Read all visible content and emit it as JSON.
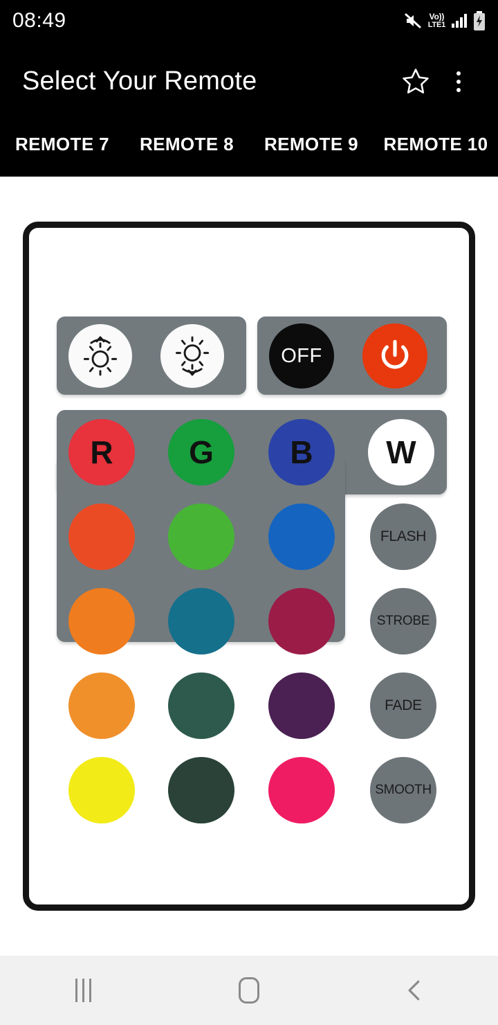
{
  "status_bar": {
    "clock": "08:49",
    "icons": [
      "mute-icon",
      "volte-icon",
      "signal-icon",
      "battery-charging-icon"
    ],
    "volte_top": "Vo))",
    "volte_bottom": "LTE1"
  },
  "app_bar": {
    "title": "Select Your Remote",
    "favorite_icon": "star-outline-icon",
    "overflow_icon": "overflow-menu-icon",
    "tabs": [
      {
        "label": "REMOTE 7",
        "selected": false
      },
      {
        "label": "REMOTE 8",
        "selected": false
      },
      {
        "label": "REMOTE 9",
        "selected": false
      },
      {
        "label": "REMOTE 10",
        "selected": false
      }
    ]
  },
  "remote": {
    "body_color": "#FFFFFF",
    "border_color": "#141414",
    "panel_color": "#727A7E",
    "top_row": [
      {
        "name": "brightness-up",
        "icon": "sun-up-icon",
        "label": "",
        "color": "#FAFAFA"
      },
      {
        "name": "brightness-down",
        "icon": "sun-down-icon",
        "label": "",
        "color": "#FAFAFA"
      },
      {
        "name": "off",
        "icon": "",
        "label": "OFF",
        "color": "#0C0C0C"
      },
      {
        "name": "power",
        "icon": "power-icon",
        "label": "",
        "color": "#E8380D"
      }
    ],
    "color_buttons": [
      {
        "label": "R",
        "color": "#E8323C"
      },
      {
        "label": "G",
        "color": "#179E3D"
      },
      {
        "label": "B",
        "color": "#2B43A8"
      },
      {
        "label": "W",
        "color": "#FFFFFF"
      },
      {
        "label": "",
        "color": "#EB4B24"
      },
      {
        "label": "",
        "color": "#47B436"
      },
      {
        "label": "",
        "color": "#1565C0"
      },
      {
        "label": "",
        "color": "#EF7C1E"
      },
      {
        "label": "",
        "color": "#15708C"
      },
      {
        "label": "",
        "color": "#9B1C47"
      },
      {
        "label": "",
        "color": "#F0902B"
      },
      {
        "label": "",
        "color": "#2D5A4C"
      },
      {
        "label": "",
        "color": "#4A2152"
      },
      {
        "label": "",
        "color": "#F2EB18"
      },
      {
        "label": "",
        "color": "#2A4238"
      },
      {
        "label": "",
        "color": "#EF1C63"
      }
    ],
    "mode_buttons": [
      {
        "label": "FLASH",
        "color": "#6E7579"
      },
      {
        "label": "STROBE",
        "color": "#6E7579"
      },
      {
        "label": "FADE",
        "color": "#6E7579"
      },
      {
        "label": "SMOOTH",
        "color": "#6E7579"
      }
    ]
  },
  "nav_bar": {
    "recents": "recents-icon",
    "home": "home-icon",
    "back": "back-icon"
  }
}
